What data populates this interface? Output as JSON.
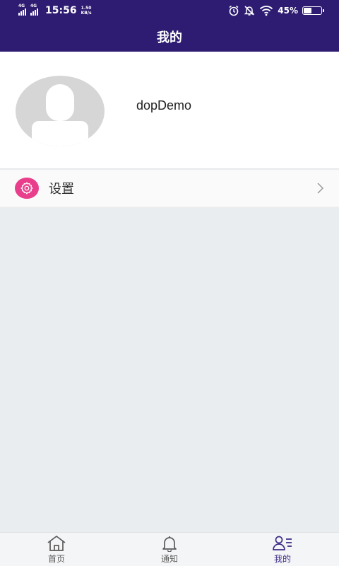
{
  "status_bar": {
    "network1": "4G",
    "network2": "4G",
    "time": "15:56",
    "speed_value": "1.50",
    "speed_unit": "KB/s",
    "battery_pct": "45%",
    "battery_level": 0.45
  },
  "header": {
    "title": "我的"
  },
  "profile": {
    "username": "dopDemo"
  },
  "menu": {
    "items": [
      {
        "label": "设置",
        "icon": "gear-icon"
      }
    ]
  },
  "bottom_nav": {
    "items": [
      {
        "label": "首页",
        "icon": "home-icon"
      },
      {
        "label": "通知",
        "icon": "bell-icon"
      },
      {
        "label": "我的",
        "icon": "user-list-icon",
        "active": true
      }
    ]
  },
  "colors": {
    "primary": "#2e1c72",
    "active_tab": "#3d2a86",
    "settings_icon_bg": "#e83e8c",
    "page_bg": "#eaedef"
  }
}
